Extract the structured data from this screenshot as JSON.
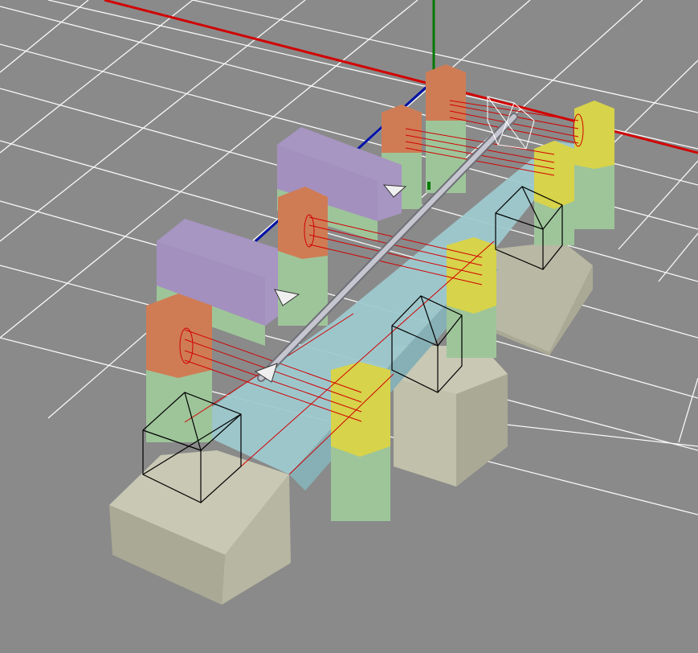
{
  "viewport": {
    "label": "",
    "background": "#8a8a8a",
    "grid_color": "#ffffff",
    "axis_colors": {
      "x": "#d10000",
      "y": "#007a00",
      "z": "#0012a8"
    }
  },
  "materials": {
    "base_top": "#c8c8b4",
    "base_left": "#a9a995",
    "base_right": "#b8b8a4",
    "pillar_green": "#9ec59a",
    "pillar_yellow": "#d7d34a",
    "pillar_orange": "#cf7c55",
    "block_purple": "#a795c2",
    "deck_cyan": "#9ec9cf",
    "rod_silver": "#b9b9c2",
    "wire_red": "#d20000",
    "wire_black": "#000000"
  },
  "icons": [
    "shaft-rod-icon",
    "gizmo-cone-icon",
    "constraint-box-icon"
  ]
}
